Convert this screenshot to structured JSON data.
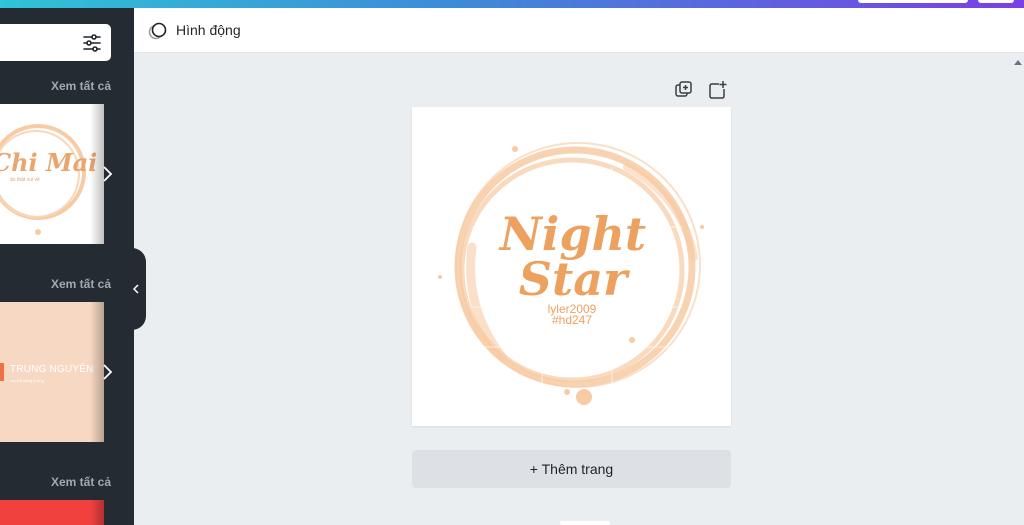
{
  "sidebar": {
    "sections": [
      {
        "see_all": "Xem tất cả",
        "thumbnail": {
          "title": "Chi Mai",
          "subtitle": "ăn thật vui vẻ"
        }
      },
      {
        "see_all": "Xem tất cả",
        "thumbnail": {
          "title": "TRUNG NGUYÊN",
          "subtitle": "cà phê năng lượng"
        }
      },
      {
        "see_all": "Xem tất cả"
      }
    ]
  },
  "header": {
    "animate_label": "Hình động"
  },
  "design": {
    "title_line1": "Night",
    "title_line2": "Star",
    "subtitle_line1": "lyler2009",
    "subtitle_line2": "#hd247",
    "colors": {
      "ring": "#f7cba4",
      "title": "#eda15f",
      "subtitle": "#eda15f"
    }
  },
  "canvas": {
    "add_page_label": "+ Thêm trang"
  },
  "colors": {
    "sidebar_bg": "#252b33",
    "canvas_bg": "#ebeef1",
    "accent": "#7b3fe4"
  }
}
